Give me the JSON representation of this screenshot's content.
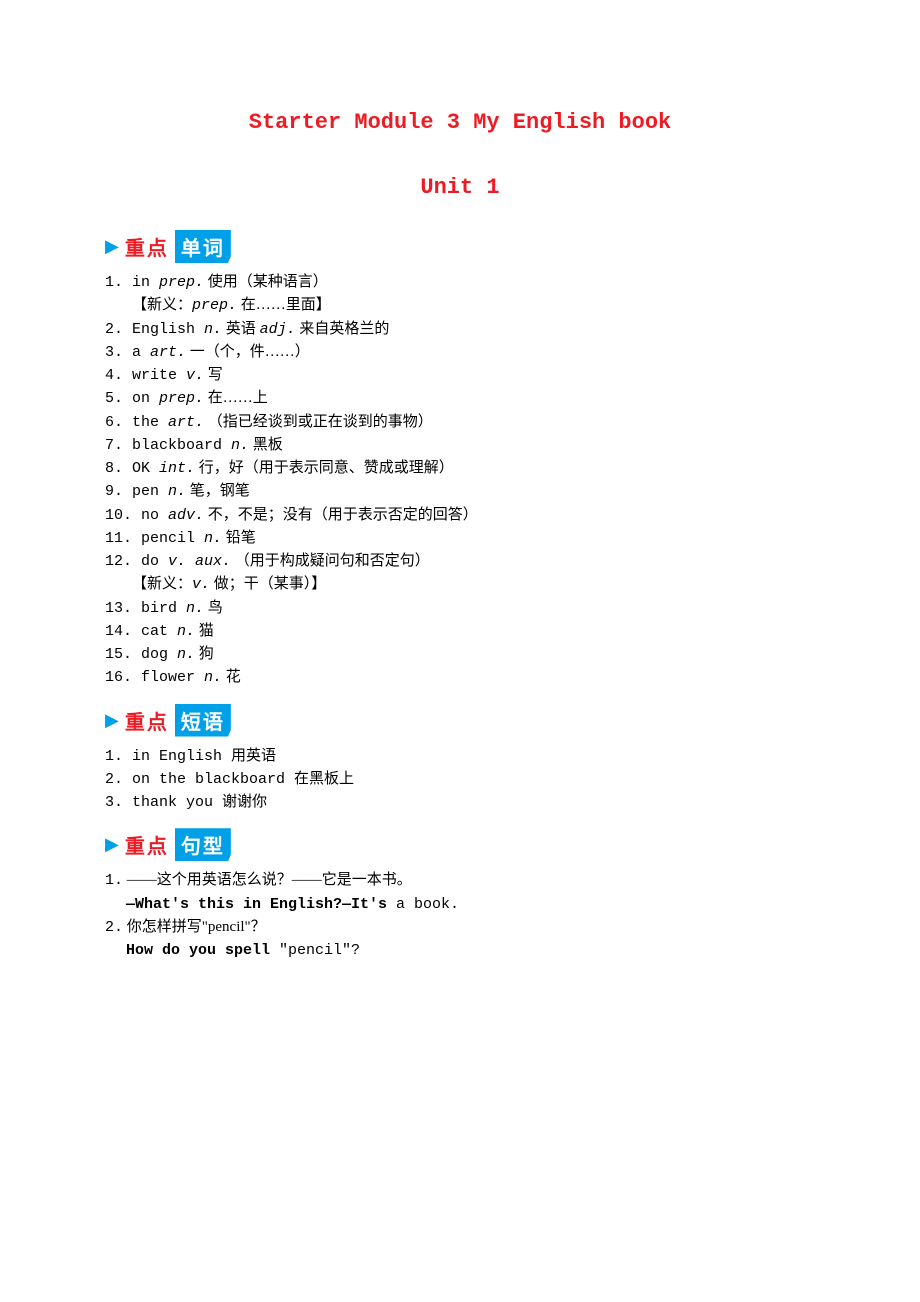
{
  "title": "Starter Module  3  My English book",
  "subtitle": "Unit 1",
  "sections": {
    "words": {
      "label_red": "重点",
      "label_blue": "单词"
    },
    "phrases": {
      "label_red": "重点",
      "label_blue": "短语"
    },
    "sentences": {
      "label_red": "重点",
      "label_blue": "句型"
    }
  },
  "words": [
    {
      "n": "1.",
      "w": "in",
      "p": "prep.",
      "d": "使用（某种语言）",
      "note_pre": "【新义：",
      "note_pos": "prep.",
      "note_post": " 在……里面】"
    },
    {
      "n": "2.",
      "w": "English",
      "p": "n.",
      "d": "英语 ",
      "p2": "adj.",
      "d2": "来自英格兰的"
    },
    {
      "n": "3.",
      "w": "a",
      "p": "art.",
      "d": " 一（个，件……）"
    },
    {
      "n": "4.",
      "w": "write",
      "p": "v.",
      "d": "写"
    },
    {
      "n": "5.",
      "w": "on",
      "p": "prep.",
      "d": "在……上"
    },
    {
      "n": "6.",
      "w": "the",
      "p": "art.",
      "d": "（指已经谈到或正在谈到的事物）"
    },
    {
      "n": "7.",
      "w": "blackboard",
      "p": "n.",
      "d": "黑板"
    },
    {
      "n": "8.",
      "w": "OK",
      "p": "int.",
      "d": "行，好（用于表示同意、赞成或理解）"
    },
    {
      "n": "9.",
      "w": "pen",
      "p": "n.",
      "d": "笔，钢笔"
    },
    {
      "n": "10.",
      "w": "no",
      "p": "adv.",
      "d": "不，不是；没有（用于表示否定的回答）"
    },
    {
      "n": "11.",
      "w": "pencil",
      "p": "n.",
      "d": "铅笔"
    },
    {
      "n": "12.",
      "w": "do",
      "p": "v. aux.",
      "d": "（用于构成疑问句和否定句）",
      "note_pre": "【新义：",
      "note_pos": "v.",
      "note_post": " 做；干（某事）】"
    },
    {
      "n": "13.",
      "w": "bird",
      "p": "n.",
      "d": "鸟"
    },
    {
      "n": "14.",
      "w": "cat",
      "p": "n.",
      "d": "猫"
    },
    {
      "n": "15.",
      "w": "dog",
      "p": "n.",
      "d": "狗"
    },
    {
      "n": "16.",
      "w": "flower",
      "p": "n.",
      "d": "花"
    }
  ],
  "phrases": [
    {
      "n": "1.",
      "w": "in English",
      "d": "用英语"
    },
    {
      "n": "2.",
      "w": "on the blackboard",
      "d": "在黑板上"
    },
    {
      "n": "3.",
      "w": "thank you",
      "d": "谢谢你"
    }
  ],
  "sentences": [
    {
      "n": "1.",
      "q": "——这个用英语怎么说？——它是一本书。",
      "ans_bold": "—What's this in English?—It's ",
      "ans_reg": "a book."
    },
    {
      "n": "2.",
      "q": "你怎样拼写\"pencil\"？",
      "ans_bold": "How do you spell ",
      "ans_reg": "\"pencil\"?"
    }
  ]
}
